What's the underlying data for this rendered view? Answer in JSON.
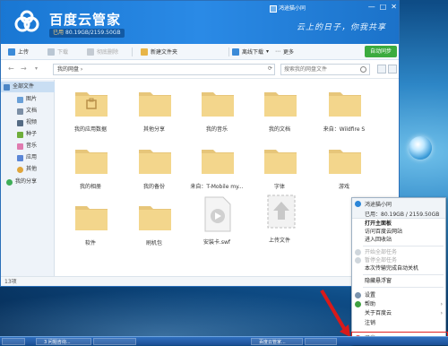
{
  "app": {
    "title": "百度云管家",
    "quota_prefix": "已用",
    "quota": "80.19GB/2159.50GB",
    "user": "鸿途猫小同",
    "slogan": "云上的日子，你我共享",
    "window_controls": [
      "—",
      "□",
      "✕"
    ]
  },
  "toolbar": {
    "upload": "上传",
    "download": "下载",
    "delete": "彻底删除",
    "new_folder": "新建文件夹",
    "offline_download": "离线下载",
    "more": "更多",
    "sync": "自动同步"
  },
  "addressbar": {
    "path": "我的网盘 ›",
    "search_placeholder": "搜索我的网盘文件"
  },
  "sidebar": [
    {
      "label": "全部文件",
      "color": "#4c86c6",
      "active": true
    },
    {
      "label": "图片",
      "color": "#6aa0d8"
    },
    {
      "label": "文档",
      "color": "#7c8fa6"
    },
    {
      "label": "视频",
      "color": "#556b84"
    },
    {
      "label": "种子",
      "color": "#6fae3c"
    },
    {
      "label": "音乐",
      "color": "#e07bb0"
    },
    {
      "label": "应用",
      "color": "#5b86d6"
    },
    {
      "label": "其他",
      "color": "#e0a63c"
    },
    {
      "label": "我的分享",
      "color": "#3fae58"
    }
  ],
  "files": [
    {
      "label": "我的应用数据",
      "type": "app-folder"
    },
    {
      "label": "其他分享",
      "type": "folder"
    },
    {
      "label": "我的音乐",
      "type": "folder"
    },
    {
      "label": "我的文档",
      "type": "folder"
    },
    {
      "label": "来自：Wildfire S",
      "type": "folder"
    },
    {
      "label": "我的相册",
      "type": "folder"
    },
    {
      "label": "我的备份",
      "type": "folder"
    },
    {
      "label": "来自：T-Mobile my...",
      "type": "folder"
    },
    {
      "label": "字体",
      "type": "folder"
    },
    {
      "label": "游戏",
      "type": "folder"
    },
    {
      "label": "软件",
      "type": "folder"
    },
    {
      "label": "刷机包",
      "type": "folder"
    },
    {
      "label": "安装卡.swf",
      "type": "swf"
    },
    {
      "label": "上传文件",
      "type": "upload"
    }
  ],
  "status": {
    "count": "13项"
  },
  "context_menu": {
    "user": "鸿途猫小同",
    "quota": "已用：80.19GB / 2159.50GB",
    "items": [
      {
        "label": "打开主面板",
        "bold": true
      },
      {
        "label": "访问百度云网站"
      },
      {
        "label": "进入回收站"
      },
      {
        "label": "开始全部任务",
        "disabled": true
      },
      {
        "label": "暂停全部任务",
        "disabled": true
      },
      {
        "label": "本次传输完成自动关机"
      },
      {
        "label": "隐藏悬浮窗"
      },
      {
        "label": "设置"
      },
      {
        "label": "帮助",
        "submenu": true
      },
      {
        "label": "关于百度云",
        "submenu": true
      },
      {
        "label": "注销"
      },
      {
        "label": "退出"
      }
    ]
  },
  "taskbar": {
    "items": [
      "",
      "3 问题咨询...",
      "",
      "百度云管家...",
      "",
      "",
      ""
    ]
  },
  "watermark": "jingyan"
}
